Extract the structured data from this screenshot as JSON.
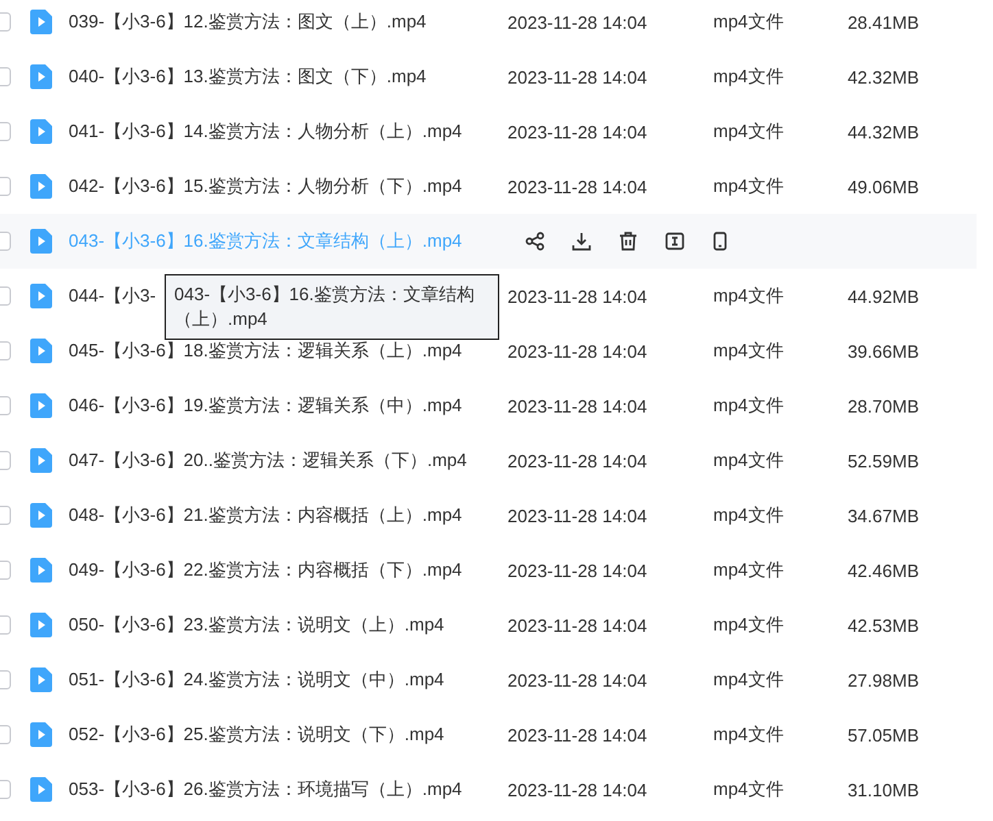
{
  "files": [
    {
      "name": "039-【小3-6】12.鉴赏方法：图文（上）.mp4",
      "date": "2023-11-28 14:04",
      "type": "mp4文件",
      "size": "28.41MB",
      "checked": false,
      "hovered": false
    },
    {
      "name": "040-【小3-6】13.鉴赏方法：图文（下）.mp4",
      "date": "2023-11-28 14:04",
      "type": "mp4文件",
      "size": "42.32MB",
      "checked": false,
      "hovered": false
    },
    {
      "name": "041-【小3-6】14.鉴赏方法：人物分析（上）.mp4",
      "date": "2023-11-28 14:04",
      "type": "mp4文件",
      "size": "44.32MB",
      "checked": false,
      "hovered": false
    },
    {
      "name": "042-【小3-6】15.鉴赏方法：人物分析（下）.mp4",
      "date": "2023-11-28 14:04",
      "type": "mp4文件",
      "size": "49.06MB",
      "checked": false,
      "hovered": false
    },
    {
      "name": "043-【小3-6】16.鉴赏方法：文章结构（上）.mp4",
      "checked": false,
      "hovered": true
    },
    {
      "name": "044-【小3-",
      "date": "2023-11-28 14:04",
      "type": "mp4文件",
      "size": "44.92MB",
      "checked": false,
      "hovered": false
    },
    {
      "name": "045-【小3-6】18.鉴赏方法：逻辑关系（上）.mp4",
      "date": "2023-11-28 14:04",
      "type": "mp4文件",
      "size": "39.66MB",
      "checked": false,
      "hovered": false
    },
    {
      "name": "046-【小3-6】19.鉴赏方法：逻辑关系（中）.mp4",
      "date": "2023-11-28 14:04",
      "type": "mp4文件",
      "size": "28.70MB",
      "checked": false,
      "hovered": false
    },
    {
      "name": "047-【小3-6】20..鉴赏方法：逻辑关系（下）.mp4",
      "date": "2023-11-28 14:04",
      "type": "mp4文件",
      "size": "52.59MB",
      "checked": false,
      "hovered": false
    },
    {
      "name": "048-【小3-6】21.鉴赏方法：内容概括（上）.mp4",
      "date": "2023-11-28 14:04",
      "type": "mp4文件",
      "size": "34.67MB",
      "checked": false,
      "hovered": false
    },
    {
      "name": "049-【小3-6】22.鉴赏方法：内容概括（下）.mp4",
      "date": "2023-11-28 14:04",
      "type": "mp4文件",
      "size": "42.46MB",
      "checked": false,
      "hovered": false
    },
    {
      "name": "050-【小3-6】23.鉴赏方法：说明文（上）.mp4",
      "date": "2023-11-28 14:04",
      "type": "mp4文件",
      "size": "42.53MB",
      "checked": false,
      "hovered": false
    },
    {
      "name": "051-【小3-6】24.鉴赏方法：说明文（中）.mp4",
      "date": "2023-11-28 14:04",
      "type": "mp4文件",
      "size": "27.98MB",
      "checked": false,
      "hovered": false
    },
    {
      "name": "052-【小3-6】25.鉴赏方法：说明文（下）.mp4",
      "date": "2023-11-28 14:04",
      "type": "mp4文件",
      "size": "57.05MB",
      "checked": false,
      "hovered": false
    },
    {
      "name": "053-【小3-6】26.鉴赏方法：环境描写（上）.mp4",
      "date": "2023-11-28 14:04",
      "type": "mp4文件",
      "size": "31.10MB",
      "checked": false,
      "hovered": false
    }
  ],
  "tooltip": {
    "text": "043-【小3-6】16.鉴赏方法：文章结构（上）.mp4"
  }
}
